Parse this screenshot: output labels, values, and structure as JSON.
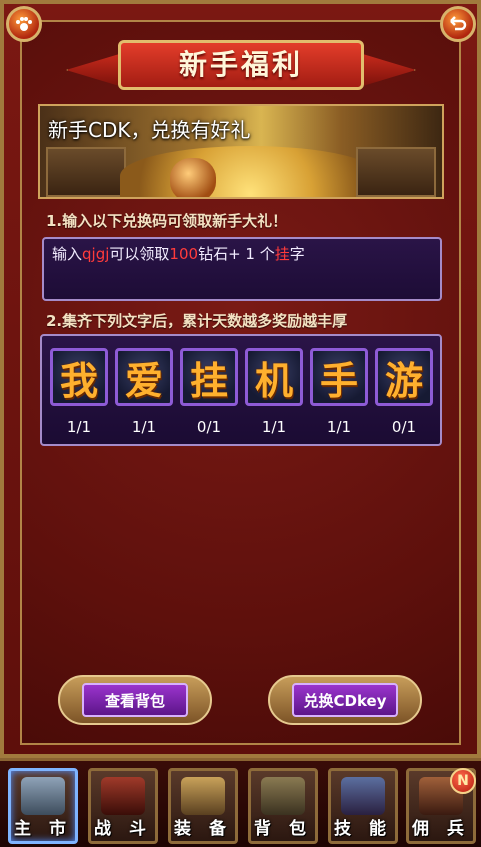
{
  "title": "新手福利",
  "banner": {
    "text": "新手CDK，兑换有好礼"
  },
  "section1": {
    "title": "1.输入以下兑换码可领取新手大礼！",
    "line_prefix": "输入",
    "code": "qjgj",
    "line_mid": "可以领取",
    "amount": "100",
    "line_after": "钻石+ 1 个",
    "highlight": "挂",
    "line_end": "字"
  },
  "section2": {
    "title": "2.集齐下列文字后，累计天数越多奖励越丰厚",
    "chars": [
      {
        "char": "我",
        "count": "1/1"
      },
      {
        "char": "爱",
        "count": "1/1"
      },
      {
        "char": "挂",
        "count": "0/1"
      },
      {
        "char": "机",
        "count": "1/1"
      },
      {
        "char": "手",
        "count": "1/1"
      },
      {
        "char": "游",
        "count": "0/1"
      }
    ]
  },
  "buttons": {
    "view_bag": "查看背包",
    "redeem": "兑换CDkey"
  },
  "nav": [
    {
      "label": "主 市",
      "icon": "castle-icon"
    },
    {
      "label": "战 斗",
      "icon": "crossed-swords-icon"
    },
    {
      "label": "装 备",
      "icon": "armor-icon"
    },
    {
      "label": "背 包",
      "icon": "backpack-icon"
    },
    {
      "label": "技 能",
      "icon": "spellbook-icon"
    },
    {
      "label": "佣 兵",
      "icon": "mercenary-icon"
    }
  ],
  "badge": "N",
  "colors": {
    "frame_red": "#6b130e",
    "gold_border": "#b28547",
    "purple_panel": "#241040",
    "char_orange": "#ffb02e",
    "highlight_red": "#ff3b3b"
  }
}
